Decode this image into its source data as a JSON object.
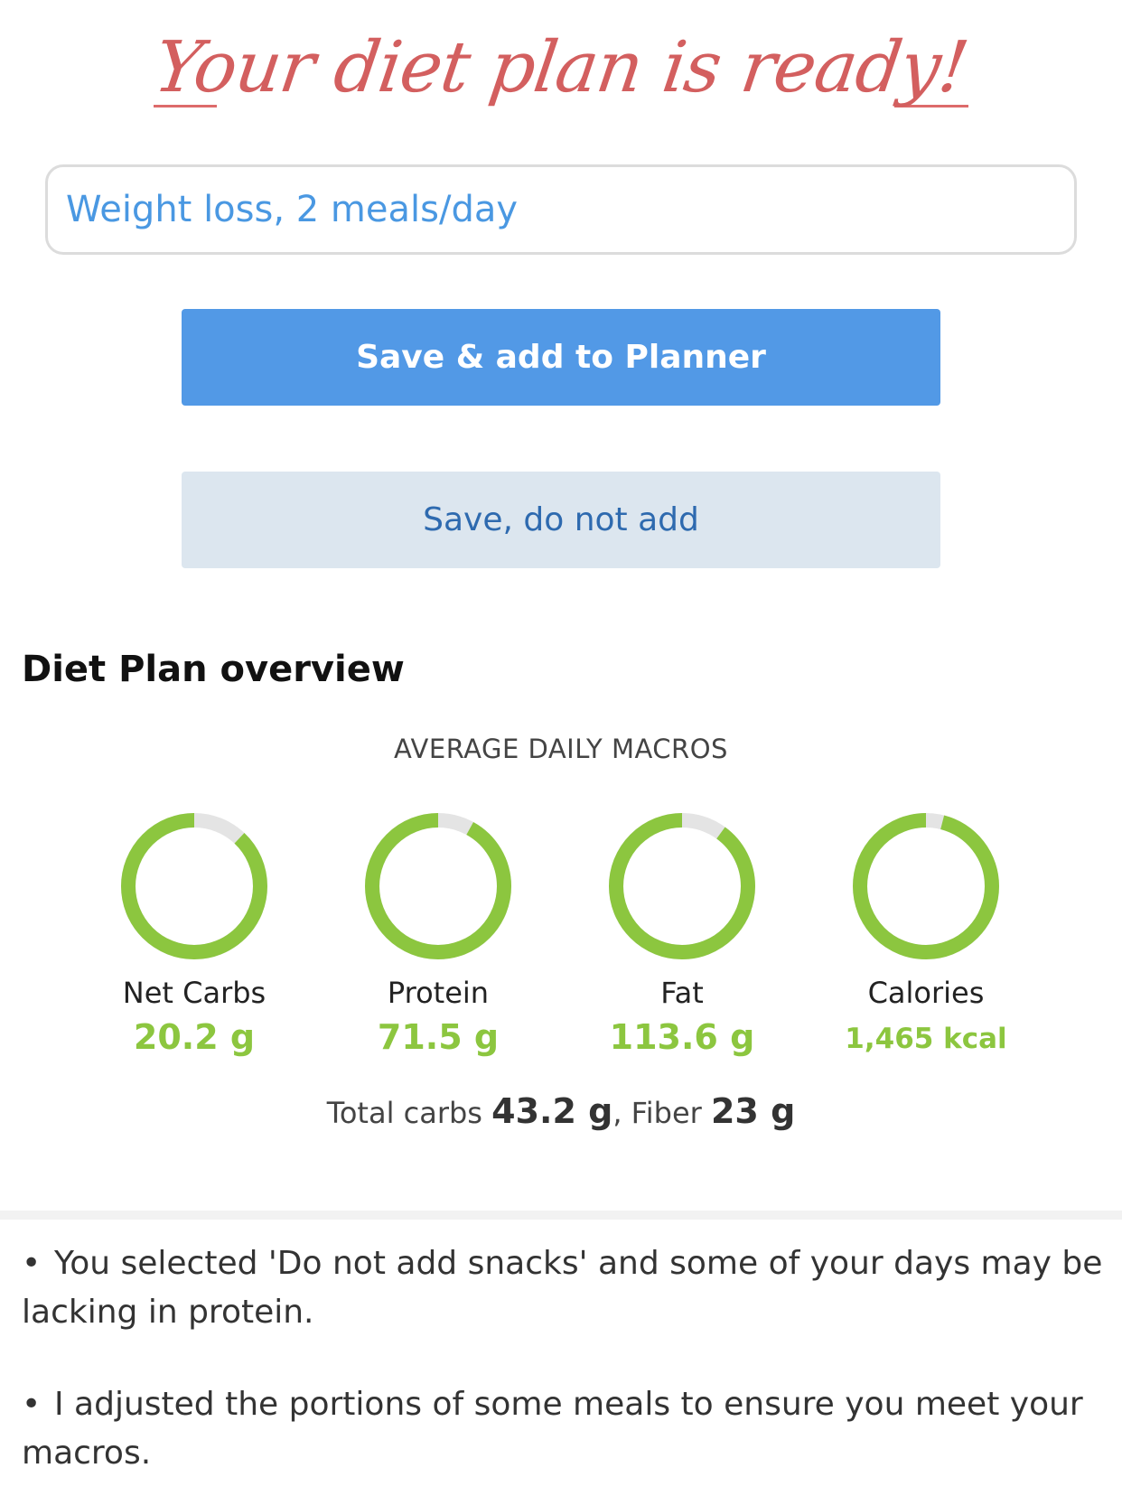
{
  "header": {
    "title": "Your diet plan is ready!"
  },
  "plan_name": {
    "value": "Weight loss, 2 meals/day"
  },
  "actions": {
    "save_add_label": "Save & add to Planner",
    "save_only_label": "Save, do not add"
  },
  "overview": {
    "title": "Diet Plan overview",
    "macros_heading": "AVERAGE DAILY MACROS",
    "macros": [
      {
        "label": "Net Carbs",
        "value": "20.2 g",
        "fill": 0.88
      },
      {
        "label": "Protein",
        "value": "71.5 g",
        "fill": 0.92
      },
      {
        "label": "Fat",
        "value": "113.6 g",
        "fill": 0.9
      },
      {
        "label": "Calories",
        "value": "1,465 kcal",
        "fill": 0.96
      }
    ],
    "totals": {
      "total_carbs_label": "Total carbs",
      "total_carbs_value": "43.2 g",
      "fiber_label": "Fiber",
      "fiber_value": "23 g"
    }
  },
  "notes": [
    "You selected 'Do not add snacks' and some of your days may be lacking in protein.",
    "I adjusted the portions of some meals to ensure you meet your macros."
  ],
  "colors": {
    "ring_fill": "#8cc63f",
    "ring_track": "#e4e4e4",
    "title": "#d35f5f",
    "primary_button": "#5299e6",
    "secondary_button": "#dce6ef"
  }
}
